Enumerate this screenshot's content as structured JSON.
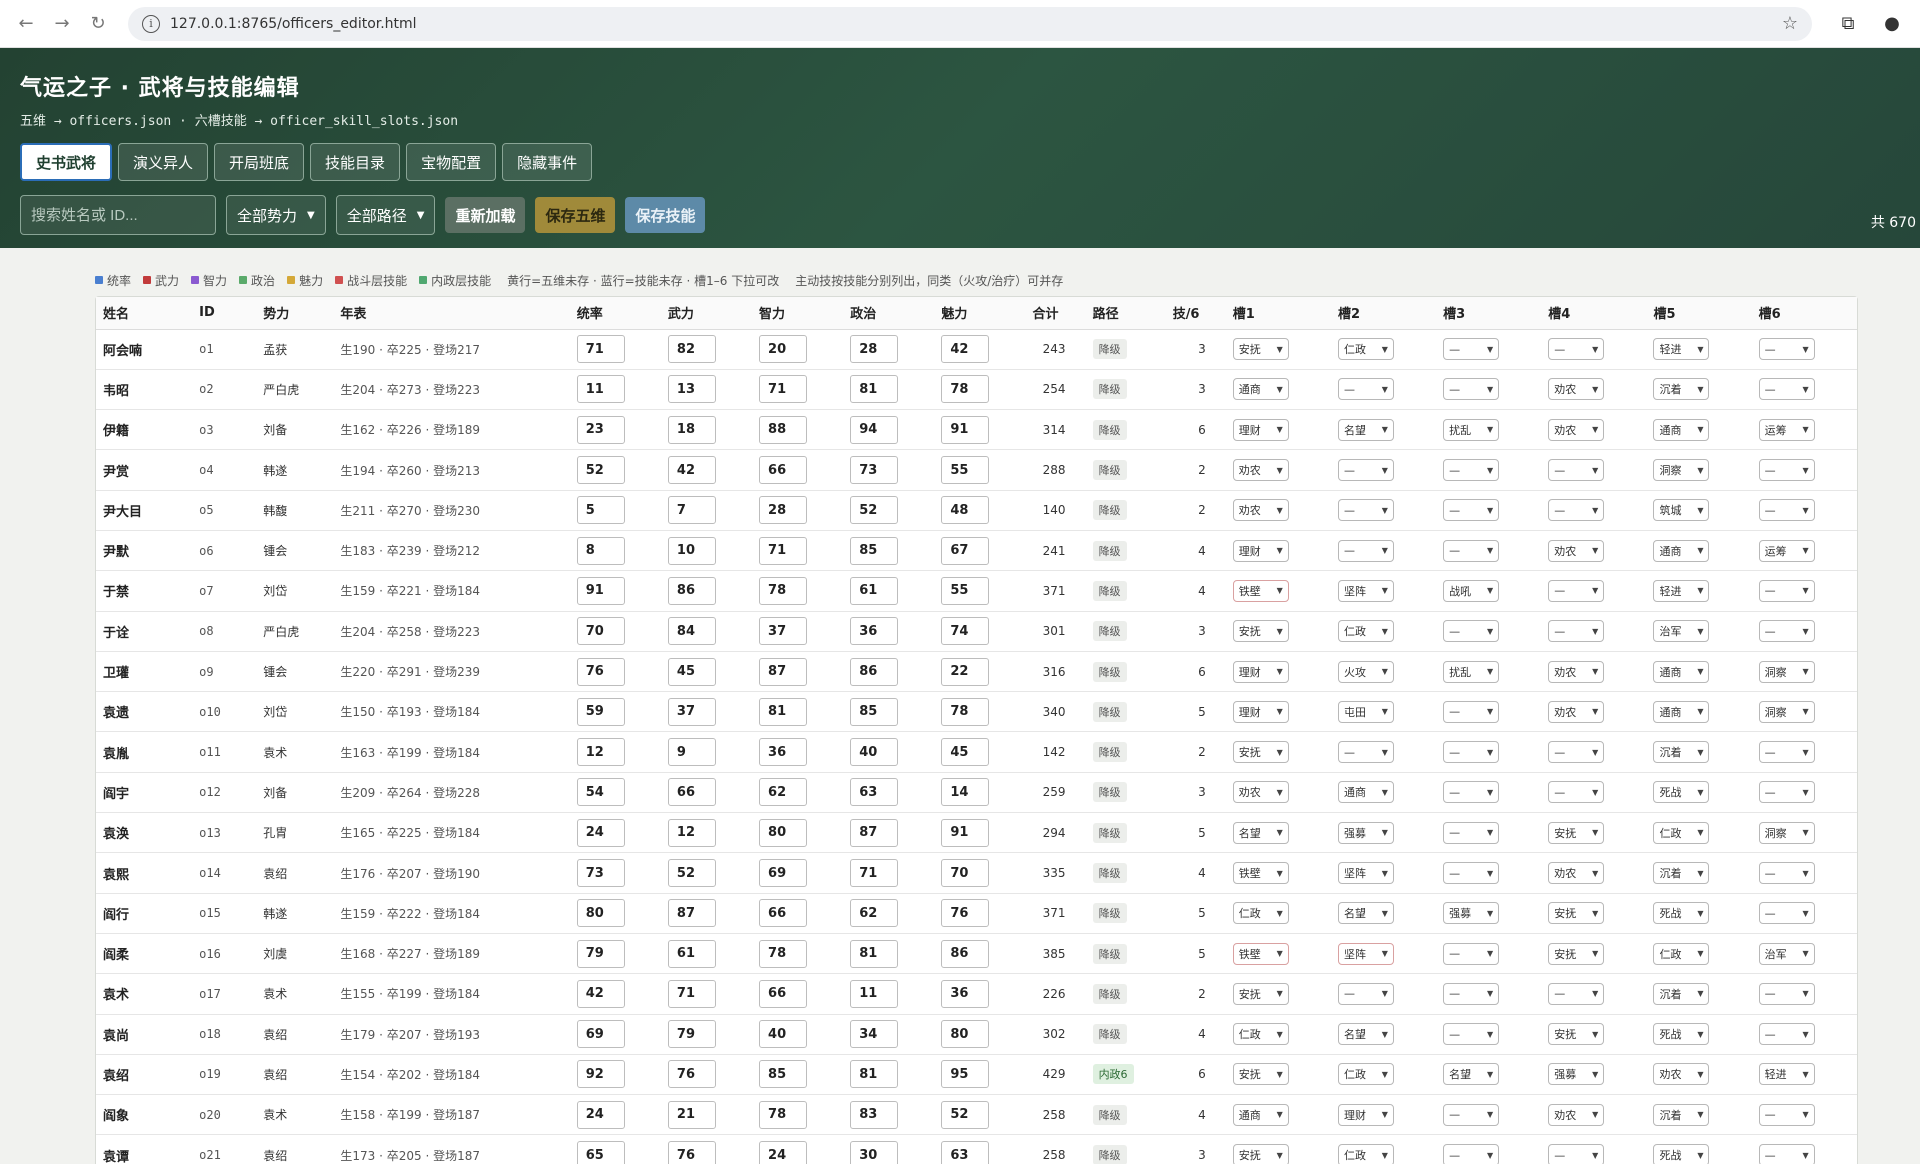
{
  "browser": {
    "url": "127.0.0.1:8765/officers_editor.html"
  },
  "header": {
    "title": "气运之子 · 武将与技能编辑",
    "subtitle": "五维 → officers.json · 六槽技能 → officer_skill_slots.json",
    "tabs": [
      "史书武将",
      "演义异人",
      "开局班底",
      "技能目录",
      "宝物配置",
      "隐藏事件"
    ],
    "search_placeholder": "搜索姓名或 ID...",
    "faction_filter": "全部势力",
    "path_filter": "全部路径",
    "reload": "重新加载",
    "save_stats": "保存五维",
    "save_skills": "保存技能",
    "total": "共 670"
  },
  "legend": {
    "items": [
      {
        "label": "统率",
        "color": "#4a7fd0"
      },
      {
        "label": "武力",
        "color": "#c23b3b"
      },
      {
        "label": "智力",
        "color": "#8a5ad0"
      },
      {
        "label": "政治",
        "color": "#5aaa6a"
      },
      {
        "label": "魅力",
        "color": "#d4a838"
      },
      {
        "label": "战斗层技能",
        "color": "#d05050"
      },
      {
        "label": "内政层技能",
        "color": "#50a870"
      }
    ],
    "note1": "黄行=五维未存 · 蓝行=技能未存 · 槽1–6 下拉可改",
    "note2": "主动技按技能分别列出，同类（火攻/治疗）可并存"
  },
  "columns": [
    "姓名",
    "ID",
    "势力",
    "年表",
    "统率",
    "武力",
    "智力",
    "政治",
    "魅力",
    "合计",
    "路径",
    "技/6",
    "槽1",
    "槽2",
    "槽3",
    "槽4",
    "槽5",
    "槽6"
  ],
  "rows": [
    {
      "name": "阿会喃",
      "id": "o1",
      "faction": "孟获",
      "bio": "生190 · 卒225 · 登场217",
      "s": [
        71,
        82,
        20,
        28,
        42
      ],
      "total": 243,
      "path": "降级",
      "skc": 3,
      "slots": [
        "安抚",
        "仁政",
        "—",
        "—",
        "轻进",
        "—"
      ]
    },
    {
      "name": "韦昭",
      "id": "o2",
      "faction": "严白虎",
      "bio": "生204 · 卒273 · 登场223",
      "s": [
        11,
        13,
        71,
        81,
        78
      ],
      "total": 254,
      "path": "降级",
      "skc": 3,
      "slots": [
        "通商",
        "—",
        "—",
        "劝农",
        "沉着",
        "—"
      ]
    },
    {
      "name": "伊籍",
      "id": "o3",
      "faction": "刘备",
      "bio": "生162 · 卒226 · 登场189",
      "s": [
        23,
        18,
        88,
        94,
        91
      ],
      "total": 314,
      "path": "降级",
      "skc": 6,
      "slots": [
        "理财",
        "名望",
        "扰乱",
        "劝农",
        "通商",
        "运筹"
      ]
    },
    {
      "name": "尹赏",
      "id": "o4",
      "faction": "韩遂",
      "bio": "生194 · 卒260 · 登场213",
      "s": [
        52,
        42,
        66,
        73,
        55
      ],
      "total": 288,
      "path": "降级",
      "skc": 2,
      "slots": [
        "劝农",
        "—",
        "—",
        "—",
        "洞察",
        "—"
      ]
    },
    {
      "name": "尹大目",
      "id": "o5",
      "faction": "韩馥",
      "bio": "生211 · 卒270 · 登场230",
      "s": [
        5,
        7,
        28,
        52,
        48
      ],
      "total": 140,
      "path": "降级",
      "skc": 2,
      "slots": [
        "劝农",
        "—",
        "—",
        "—",
        "筑城",
        "—"
      ]
    },
    {
      "name": "尹默",
      "id": "o6",
      "faction": "锺会",
      "bio": "生183 · 卒239 · 登场212",
      "s": [
        8,
        10,
        71,
        85,
        67
      ],
      "total": 241,
      "path": "降级",
      "skc": 4,
      "slots": [
        "理财",
        "—",
        "—",
        "劝农",
        "通商",
        "运筹"
      ]
    },
    {
      "name": "于禁",
      "id": "o7",
      "faction": "刘岱",
      "bio": "生159 · 卒221 · 登场184",
      "s": [
        91,
        86,
        78,
        61,
        55
      ],
      "total": 371,
      "path": "降级",
      "skc": 4,
      "slots": [
        "铁壁",
        "坚阵",
        "战吼",
        "—",
        "轻进",
        "—"
      ]
    },
    {
      "name": "于诠",
      "id": "o8",
      "faction": "严白虎",
      "bio": "生204 · 卒258 · 登场223",
      "s": [
        70,
        84,
        37,
        36,
        74
      ],
      "total": 301,
      "path": "降级",
      "skc": 3,
      "slots": [
        "安抚",
        "仁政",
        "—",
        "—",
        "治军",
        "—"
      ]
    },
    {
      "name": "卫瓘",
      "id": "o9",
      "faction": "锺会",
      "bio": "生220 · 卒291 · 登场239",
      "s": [
        76,
        45,
        87,
        86,
        22
      ],
      "total": 316,
      "path": "降级",
      "skc": 6,
      "slots": [
        "理财",
        "火攻",
        "扰乱",
        "劝农",
        "通商",
        "洞察"
      ]
    },
    {
      "name": "袁遗",
      "id": "o10",
      "faction": "刘岱",
      "bio": "生150 · 卒193 · 登场184",
      "s": [
        59,
        37,
        81,
        85,
        78
      ],
      "total": 340,
      "path": "降级",
      "skc": 5,
      "slots": [
        "理财",
        "屯田",
        "—",
        "劝农",
        "通商",
        "洞察"
      ]
    },
    {
      "name": "袁胤",
      "id": "o11",
      "faction": "袁术",
      "bio": "生163 · 卒199 · 登场184",
      "s": [
        12,
        9,
        36,
        40,
        45
      ],
      "total": 142,
      "path": "降级",
      "skc": 2,
      "slots": [
        "安抚",
        "—",
        "—",
        "—",
        "沉着",
        "—"
      ]
    },
    {
      "name": "阎宇",
      "id": "o12",
      "faction": "刘备",
      "bio": "生209 · 卒264 · 登场228",
      "s": [
        54,
        66,
        62,
        63,
        14
      ],
      "total": 259,
      "path": "降级",
      "skc": 3,
      "slots": [
        "劝农",
        "通商",
        "—",
        "—",
        "死战",
        "—"
      ]
    },
    {
      "name": "袁涣",
      "id": "o13",
      "faction": "孔胄",
      "bio": "生165 · 卒225 · 登场184",
      "s": [
        24,
        12,
        80,
        87,
        91
      ],
      "total": 294,
      "path": "降级",
      "skc": 5,
      "slots": [
        "名望",
        "强募",
        "—",
        "安抚",
        "仁政",
        "洞察"
      ]
    },
    {
      "name": "袁熙",
      "id": "o14",
      "faction": "袁绍",
      "bio": "生176 · 卒207 · 登场190",
      "s": [
        73,
        52,
        69,
        71,
        70
      ],
      "total": 335,
      "path": "降级",
      "skc": 4,
      "slots": [
        "铁壁",
        "坚阵",
        "—",
        "劝农",
        "沉着",
        "—"
      ]
    },
    {
      "name": "阎行",
      "id": "o15",
      "faction": "韩遂",
      "bio": "生159 · 卒222 · 登场184",
      "s": [
        80,
        87,
        66,
        62,
        76
      ],
      "total": 371,
      "path": "降级",
      "skc": 5,
      "slots": [
        "仁政",
        "名望",
        "强募",
        "安抚",
        "死战",
        "—"
      ]
    },
    {
      "name": "阎柔",
      "id": "o16",
      "faction": "刘虞",
      "bio": "生168 · 卒227 · 登场189",
      "s": [
        79,
        61,
        78,
        81,
        86
      ],
      "total": 385,
      "path": "降级",
      "skc": 5,
      "slots": [
        "铁壁",
        "坚阵",
        "—",
        "安抚",
        "仁政",
        "治军"
      ]
    },
    {
      "name": "袁术",
      "id": "o17",
      "faction": "袁术",
      "bio": "生155 · 卒199 · 登场184",
      "s": [
        42,
        71,
        66,
        11,
        36
      ],
      "total": 226,
      "path": "降级",
      "skc": 2,
      "slots": [
        "安抚",
        "—",
        "—",
        "—",
        "沉着",
        "—"
      ]
    },
    {
      "name": "袁尚",
      "id": "o18",
      "faction": "袁绍",
      "bio": "生179 · 卒207 · 登场193",
      "s": [
        69,
        79,
        40,
        34,
        80
      ],
      "total": 302,
      "path": "降级",
      "skc": 4,
      "slots": [
        "仁政",
        "名望",
        "—",
        "安抚",
        "死战",
        "—"
      ]
    },
    {
      "name": "袁绍",
      "id": "o19",
      "faction": "袁绍",
      "bio": "生154 · 卒202 · 登场184",
      "s": [
        92,
        76,
        85,
        81,
        95
      ],
      "total": 429,
      "path": "内政6",
      "skc": 6,
      "slots": [
        "安抚",
        "仁政",
        "名望",
        "强募",
        "劝农",
        "轻进"
      ]
    },
    {
      "name": "阎象",
      "id": "o20",
      "faction": "袁术",
      "bio": "生158 · 卒199 · 登场187",
      "s": [
        24,
        21,
        78,
        83,
        52
      ],
      "total": 258,
      "path": "降级",
      "skc": 4,
      "slots": [
        "通商",
        "理财",
        "—",
        "劝农",
        "沉着",
        "—"
      ]
    },
    {
      "name": "袁谭",
      "id": "o21",
      "faction": "袁绍",
      "bio": "生173 · 卒205 · 登场187",
      "s": [
        65,
        76,
        24,
        30,
        63
      ],
      "total": 258,
      "path": "降级",
      "skc": 3,
      "slots": [
        "安抚",
        "仁政",
        "—",
        "—",
        "死战",
        "—"
      ]
    }
  ]
}
